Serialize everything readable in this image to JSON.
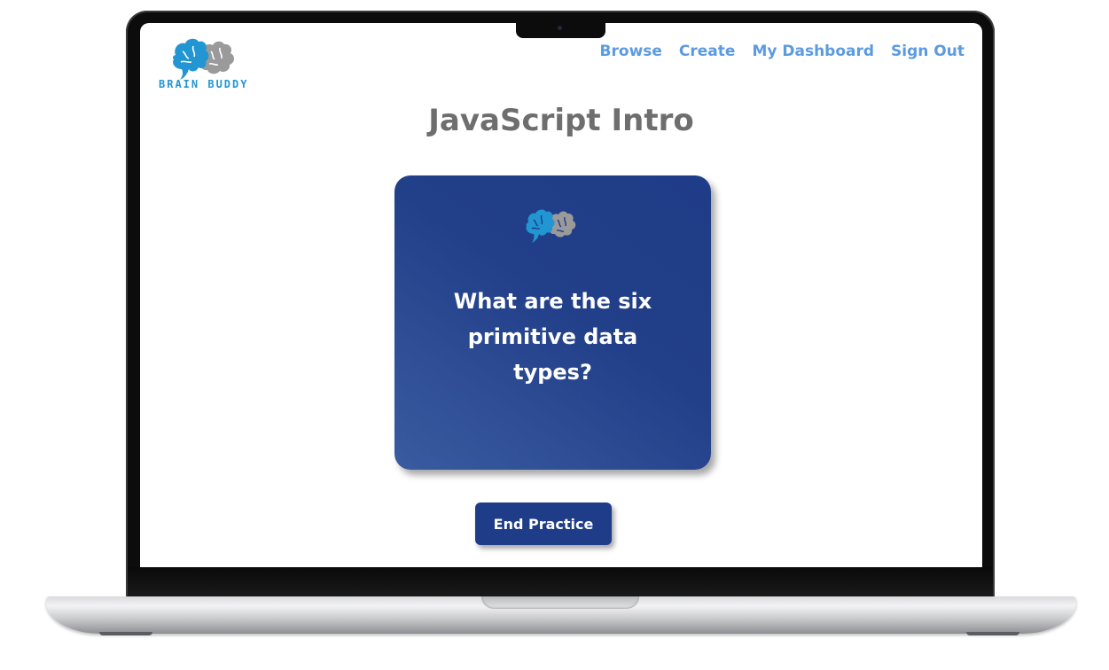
{
  "brand": {
    "name": "Brain Buddy",
    "logo_icon": "brain-icon",
    "colors": {
      "primary_blue": "#2196d3",
      "secondary_gray": "#9a9a9a"
    }
  },
  "nav": {
    "items": [
      {
        "label": "Browse"
      },
      {
        "label": "Create"
      },
      {
        "label": "My Dashboard"
      },
      {
        "label": "Sign Out"
      }
    ],
    "color": "#5b9be0"
  },
  "main": {
    "title": "JavaScript Intro",
    "flashcard": {
      "icon": "brain-icon",
      "question": "What are the six primitive data types?",
      "background": "#1f3c88"
    },
    "end_button_label": "End Practice"
  }
}
